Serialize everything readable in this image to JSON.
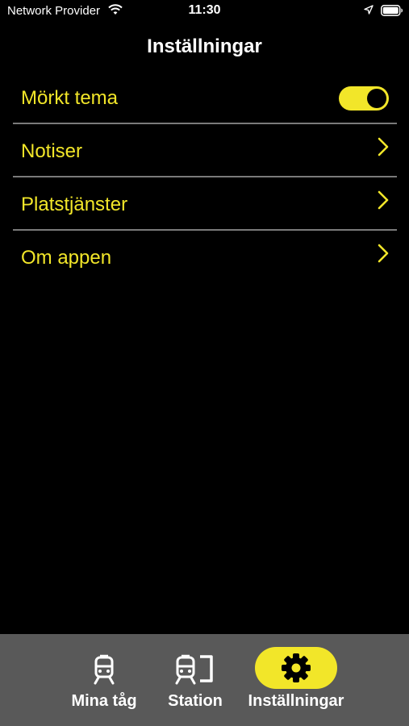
{
  "status_bar": {
    "carrier": "Network Provider",
    "time": "11:30",
    "icons": [
      "wifi-icon",
      "location-arrow-icon",
      "battery-icon"
    ]
  },
  "header": {
    "title": "Inställningar"
  },
  "settings": {
    "items": [
      {
        "label": "Mörkt tema",
        "control": "toggle",
        "on": true
      },
      {
        "label": "Notiser",
        "control": "chevron"
      },
      {
        "label": "Platstjänster",
        "control": "chevron"
      },
      {
        "label": "Om appen",
        "control": "chevron"
      }
    ]
  },
  "tabbar": {
    "tabs": [
      {
        "label": "Mina tåg",
        "icon": "train-icon",
        "active": false
      },
      {
        "label": "Station",
        "icon": "train-station-icon",
        "active": false
      },
      {
        "label": "Inställningar",
        "icon": "gear-icon",
        "active": true
      }
    ]
  },
  "colors": {
    "background": "#000000",
    "accent": "#f2e629",
    "divider": "#7a7a7a",
    "tabbar": "#595959",
    "text": "#ffffff"
  }
}
